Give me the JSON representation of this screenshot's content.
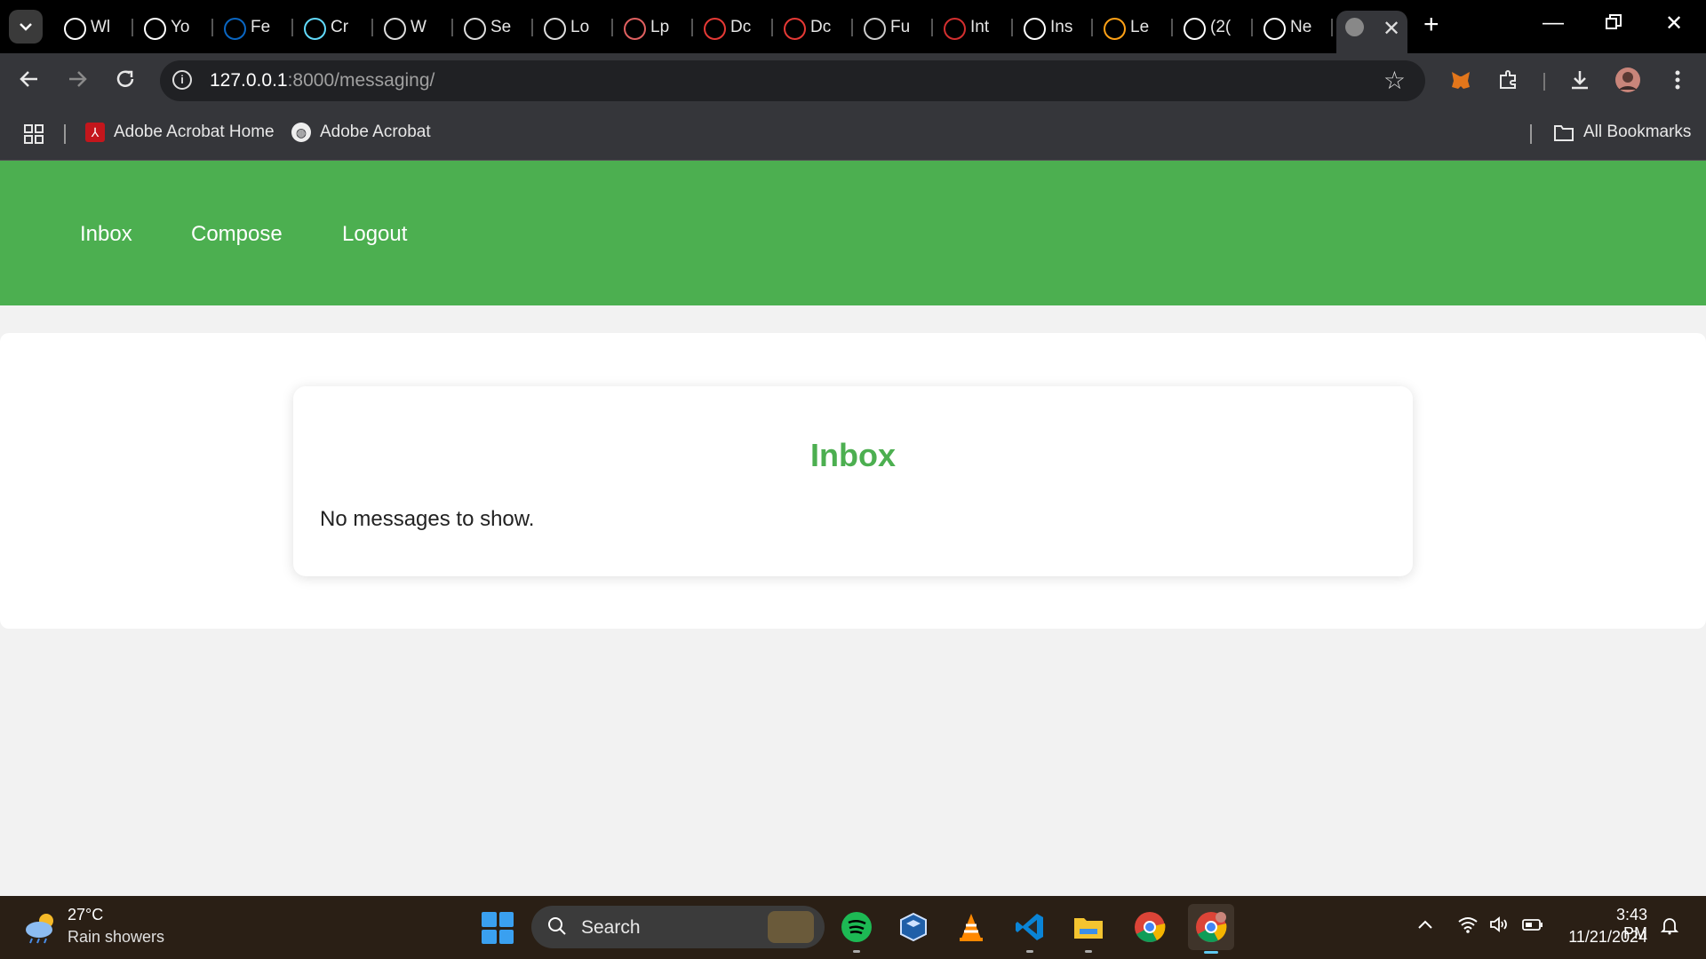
{
  "browser": {
    "tabs": [
      {
        "title": "Wl",
        "icon": "chrome-icon",
        "color": "#ffffff"
      },
      {
        "title": "Yo",
        "icon": "github-icon",
        "color": "#ffffff"
      },
      {
        "title": "Fe",
        "icon": "linkedin-icon",
        "color": "#0a66c2"
      },
      {
        "title": "Cr",
        "icon": "react-icon",
        "color": "#61dafb"
      },
      {
        "title": "W",
        "icon": "globe-icon",
        "color": "#dddddd"
      },
      {
        "title": "Se",
        "icon": "globe-icon",
        "color": "#dddddd"
      },
      {
        "title": "Lo",
        "icon": "globe-icon",
        "color": "#dddddd"
      },
      {
        "title": "Lp",
        "icon": "lp-icon",
        "color": "#e06060"
      },
      {
        "title": "Dc",
        "icon": "gmail-icon",
        "color": "#e53935"
      },
      {
        "title": "Dc",
        "icon": "gmail-icon",
        "color": "#e53935"
      },
      {
        "title": "Fu",
        "icon": "circle-icon",
        "color": "#cccccc"
      },
      {
        "title": "Int",
        "icon": "arc-icon",
        "color": "#d32f2f"
      },
      {
        "title": "Ins",
        "icon": "openai-icon",
        "color": "#ffffff"
      },
      {
        "title": "Le",
        "icon": "leetcode-icon",
        "color": "#ffa116"
      },
      {
        "title": "(2(",
        "icon": "x-icon",
        "color": "#ffffff"
      },
      {
        "title": "Ne",
        "icon": "chrome-icon",
        "color": "#ffffff"
      }
    ],
    "active_tab_icon": "globe-icon",
    "url_host": "127.0.0.1",
    "url_path": ":8000/messaging/",
    "bookmarks": [
      "Adobe Acrobat Home",
      "Adobe Acrobat"
    ],
    "all_bookmarks": "All Bookmarks"
  },
  "site": {
    "nav": [
      "Inbox",
      "Compose",
      "Logout"
    ],
    "accent": "#4caf50",
    "heading": "Inbox",
    "empty_message": "No messages to show."
  },
  "taskbar": {
    "temperature": "27°C",
    "weather": "Rain showers",
    "search_placeholder": "Search",
    "time": "3:43 PM",
    "date": "11/21/2024"
  }
}
